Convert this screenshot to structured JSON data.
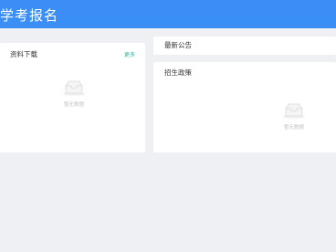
{
  "header": {
    "title": "学考报名"
  },
  "downloads": {
    "title": "资料下载",
    "more_label": "更多",
    "empty_text": "暂无数据",
    "empty_icon": "inbox-icon"
  },
  "news": {
    "title": "最新公告"
  },
  "policy": {
    "title": "招生政策",
    "empty_text": "暂无数据",
    "empty_icon": "inbox-icon"
  },
  "colors": {
    "header_bg": "#3a8ef6",
    "page_bg": "#eef0f4",
    "more_link": "#2bb2a6",
    "empty_icon": "#d9d9d9"
  }
}
